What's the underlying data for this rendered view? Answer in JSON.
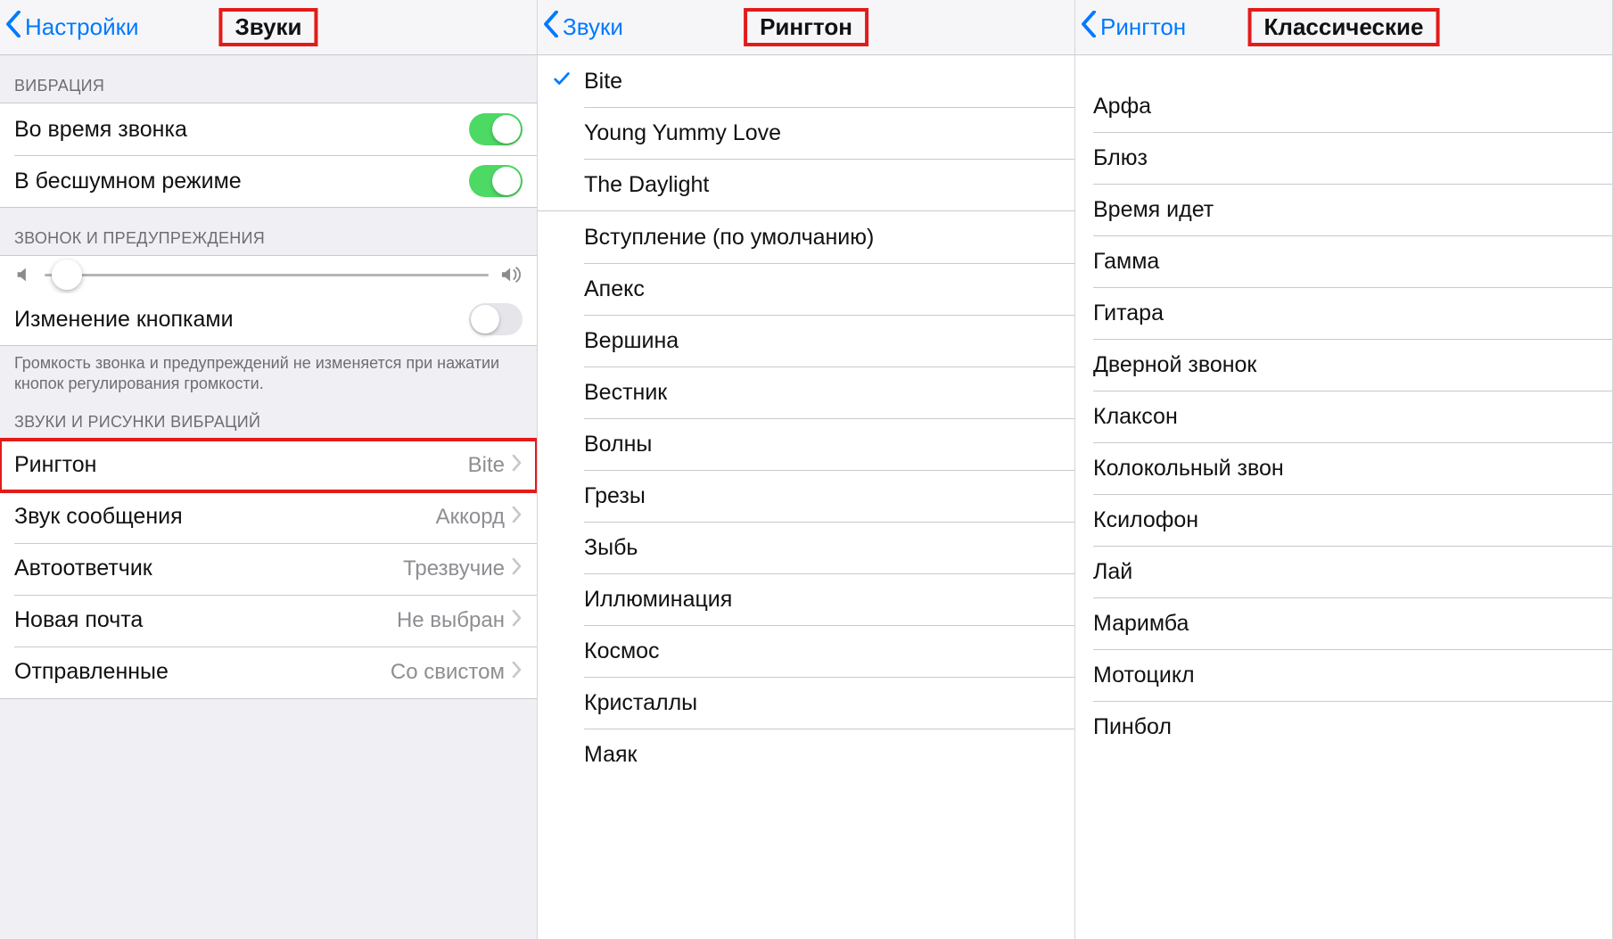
{
  "pane1": {
    "back_label": "Настройки",
    "title": "Звуки",
    "sections": {
      "vibration_header": "ВИБРАЦИЯ",
      "vibrate_on_ring": "Во время звонка",
      "vibrate_on_silent": "В бесшумном режиме",
      "ringer_header": "ЗВОНОК И ПРЕДУПРЕЖДЕНИЯ",
      "change_with_buttons": "Изменение кнопками",
      "footer_text": "Громкость звонка и предупреждений не изменяется при нажатии кнопок регулирования громкости.",
      "sounds_header": "ЗВУКИ И РИСУНКИ ВИБРАЦИЙ"
    },
    "toggles": {
      "vibrate_on_ring": true,
      "vibrate_on_silent": true,
      "change_with_buttons": false
    },
    "slider_value_percent": 5,
    "rows": {
      "ringtone": {
        "label": "Рингтон",
        "value": "Bite"
      },
      "text_tone": {
        "label": "Звук сообщения",
        "value": "Аккорд"
      },
      "voicemail": {
        "label": "Автоответчик",
        "value": "Трезвучие"
      },
      "new_mail": {
        "label": "Новая почта",
        "value": "Не выбран"
      },
      "sent_mail": {
        "label": "Отправленные",
        "value": "Со свистом"
      }
    }
  },
  "pane2": {
    "back_label": "Звуки",
    "title": "Рингтон",
    "selected": "Bite",
    "custom_tones": [
      "Bite",
      "Young Yummy Love",
      "The Daylight"
    ],
    "builtin_tones": [
      "Вступление (по умолчанию)",
      "Апекс",
      "Вершина",
      "Вестник",
      "Волны",
      "Грезы",
      "Зыбь",
      "Иллюминация",
      "Космос",
      "Кристаллы",
      "Маяк"
    ]
  },
  "pane3": {
    "back_label": "Рингтон",
    "title": "Классические",
    "tones": [
      "Арфа",
      "Блюз",
      "Время идет",
      "Гамма",
      "Гитара",
      "Дверной звонок",
      "Клаксон",
      "Колокольный звон",
      "Ксилофон",
      "Лай",
      "Маримба",
      "Мотоцикл",
      "Пинбол"
    ]
  },
  "icons": {
    "back": "chevron-left-icon",
    "disclosure": "chevron-right-icon",
    "check": "checkmark-icon",
    "vol_low": "volume-low-icon",
    "vol_high": "volume-high-icon"
  }
}
